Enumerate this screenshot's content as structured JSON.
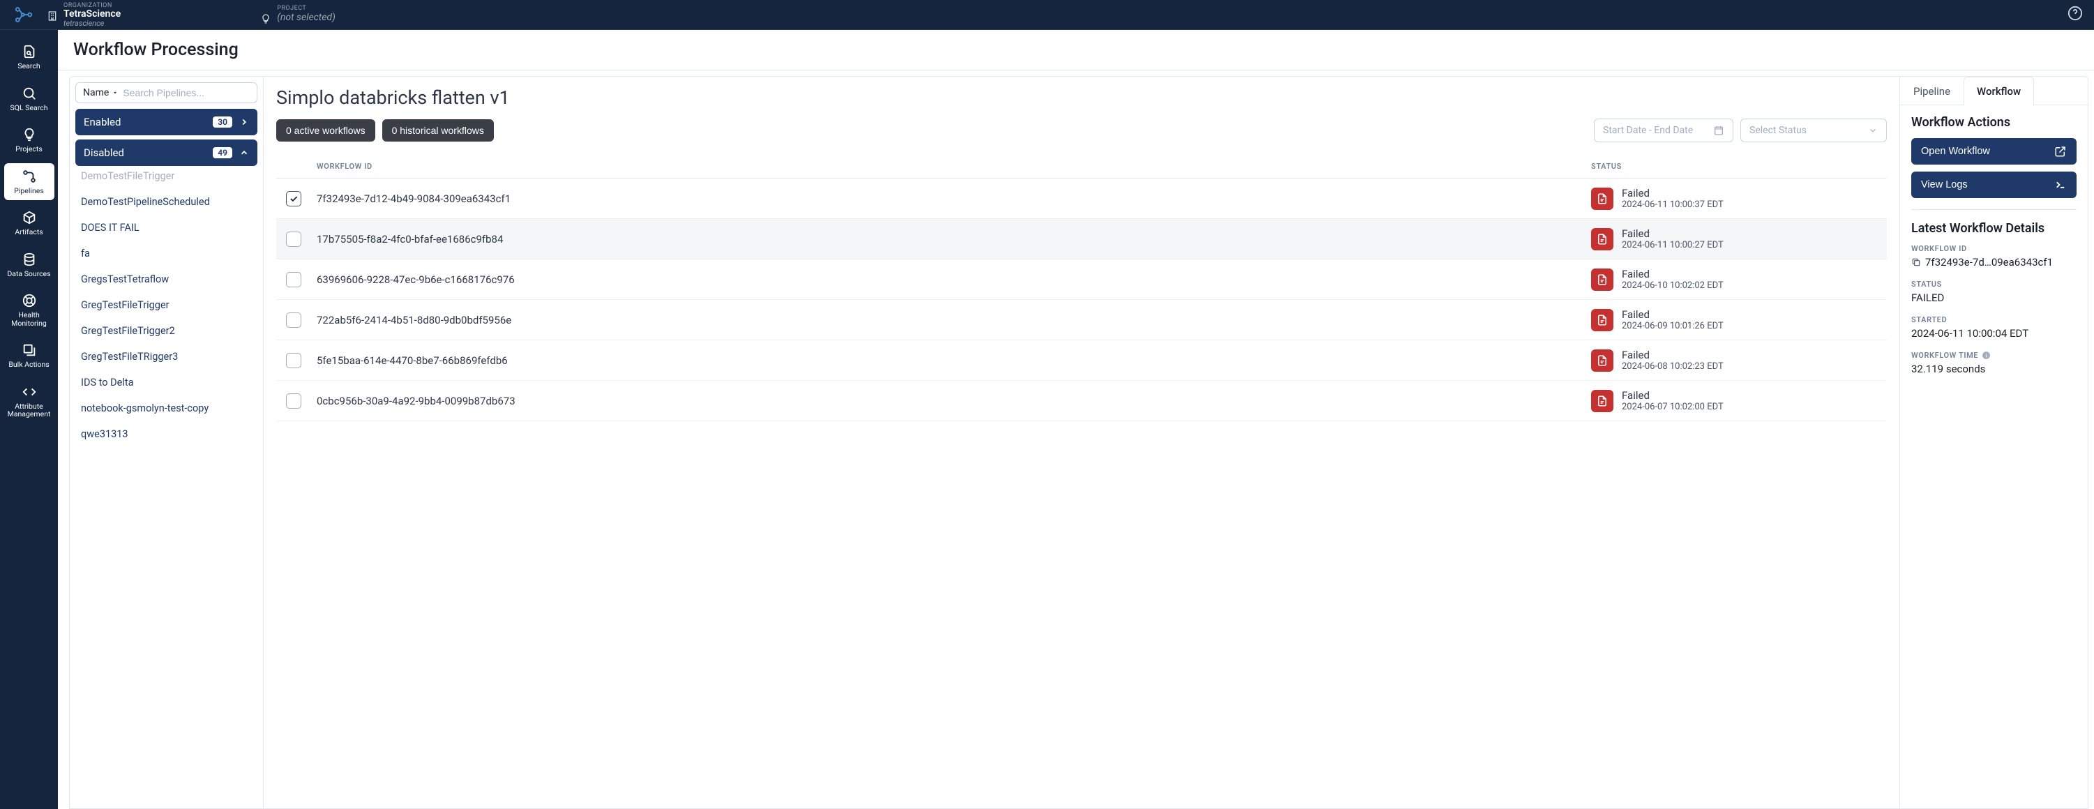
{
  "header": {
    "org_label": "ORGANIZATION",
    "org_name": "TetraScience",
    "org_slug": "tetrascience",
    "project_label": "PROJECT",
    "project_value": "(not selected)"
  },
  "nav": {
    "items": [
      {
        "label": "Search"
      },
      {
        "label": "SQL Search"
      },
      {
        "label": "Projects"
      },
      {
        "label": "Pipelines"
      },
      {
        "label": "Artifacts"
      },
      {
        "label": "Data Sources"
      },
      {
        "label": "Health Monitoring"
      },
      {
        "label": "Bulk Actions"
      },
      {
        "label": "Attribute Management"
      }
    ]
  },
  "page": {
    "title": "Workflow Processing"
  },
  "pipe_col": {
    "filter_label": "Name",
    "search_placeholder": "Search Pipelines...",
    "groups": {
      "enabled": {
        "label": "Enabled",
        "count": "30"
      },
      "disabled": {
        "label": "Disabled",
        "count": "49"
      }
    },
    "items": [
      "DemoTestFileTrigger",
      "DemoTestPipelineScheduled",
      "DOES IT FAIL",
      "fa",
      "GregsTestTetraflow",
      "GregTestFileTrigger",
      "GregTestFileTrigger2",
      "GregTestFileTRigger3",
      "IDS to Delta",
      "notebook-gsmolyn-test-copy",
      "qwe31313"
    ]
  },
  "workflow": {
    "title": "Simplo databricks flatten v1",
    "active_label": "0 active workflows",
    "historical_label": "0 historical workflows",
    "date_placeholder": "Start Date - End Date",
    "status_placeholder": "Select Status",
    "columns": {
      "id": "WORKFLOW ID",
      "status": "STATUS"
    },
    "rows": [
      {
        "checked": true,
        "id": "7f32493e-7d12-4b49-9084-309ea6343cf1",
        "status": "Failed",
        "time": "2024-06-11 10:00:37 EDT"
      },
      {
        "checked": false,
        "id": "17b75505-f8a2-4fc0-bfaf-ee1686c9fb84",
        "status": "Failed",
        "time": "2024-06-11 10:00:27 EDT"
      },
      {
        "checked": false,
        "id": "63969606-9228-47ec-9b6e-c1668176c976",
        "status": "Failed",
        "time": "2024-06-10 10:02:02 EDT"
      },
      {
        "checked": false,
        "id": "722ab5f6-2414-4b51-8d80-9db0bdf5956e",
        "status": "Failed",
        "time": "2024-06-09 10:01:26 EDT"
      },
      {
        "checked": false,
        "id": "5fe15baa-614e-4470-8be7-66b869fefdb6",
        "status": "Failed",
        "time": "2024-06-08 10:02:23 EDT"
      },
      {
        "checked": false,
        "id": "0cbc956b-30a9-4a92-9bb4-0099b87db673",
        "status": "Failed",
        "time": "2024-06-07 10:02:00 EDT"
      }
    ]
  },
  "details": {
    "tabs": {
      "pipeline": "Pipeline",
      "workflow": "Workflow"
    },
    "actions_title": "Workflow Actions",
    "open_btn": "Open Workflow",
    "logs_btn": "View Logs",
    "latest_title": "Latest Workflow Details",
    "wf_id_label": "WORKFLOW ID",
    "wf_id_value": "7f32493e-7d…09ea6343cf1",
    "status_label": "STATUS",
    "status_value": "FAILED",
    "started_label": "STARTED",
    "started_value": "2024-06-11 10:00:04 EDT",
    "time_label": "WORKFLOW TIME",
    "time_value": "32.119 seconds"
  }
}
